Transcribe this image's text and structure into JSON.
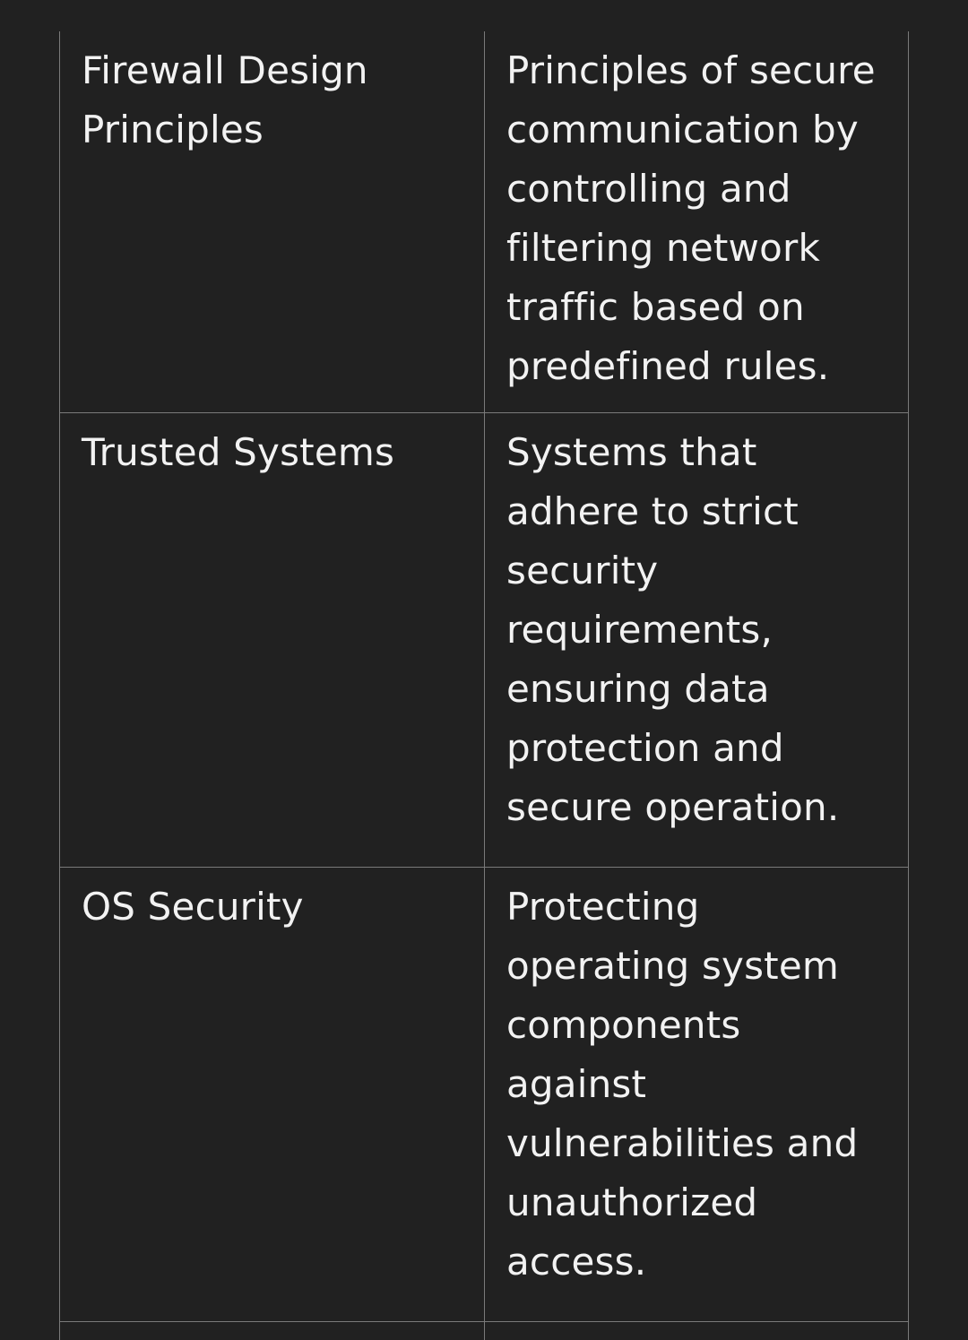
{
  "table": {
    "rows": [
      {
        "term": "Firewall Design Principles",
        "description": "Principles of secure communication by controlling and filtering network traffic based on predefined rules."
      },
      {
        "term": "Trusted Systems",
        "description": "Systems that adhere to strict security requirements, ensuring data protection and secure operation."
      },
      {
        "term": "OS Security",
        "description": "Protecting operating system components against vulnerabilities and unauthorized access."
      }
    ]
  }
}
